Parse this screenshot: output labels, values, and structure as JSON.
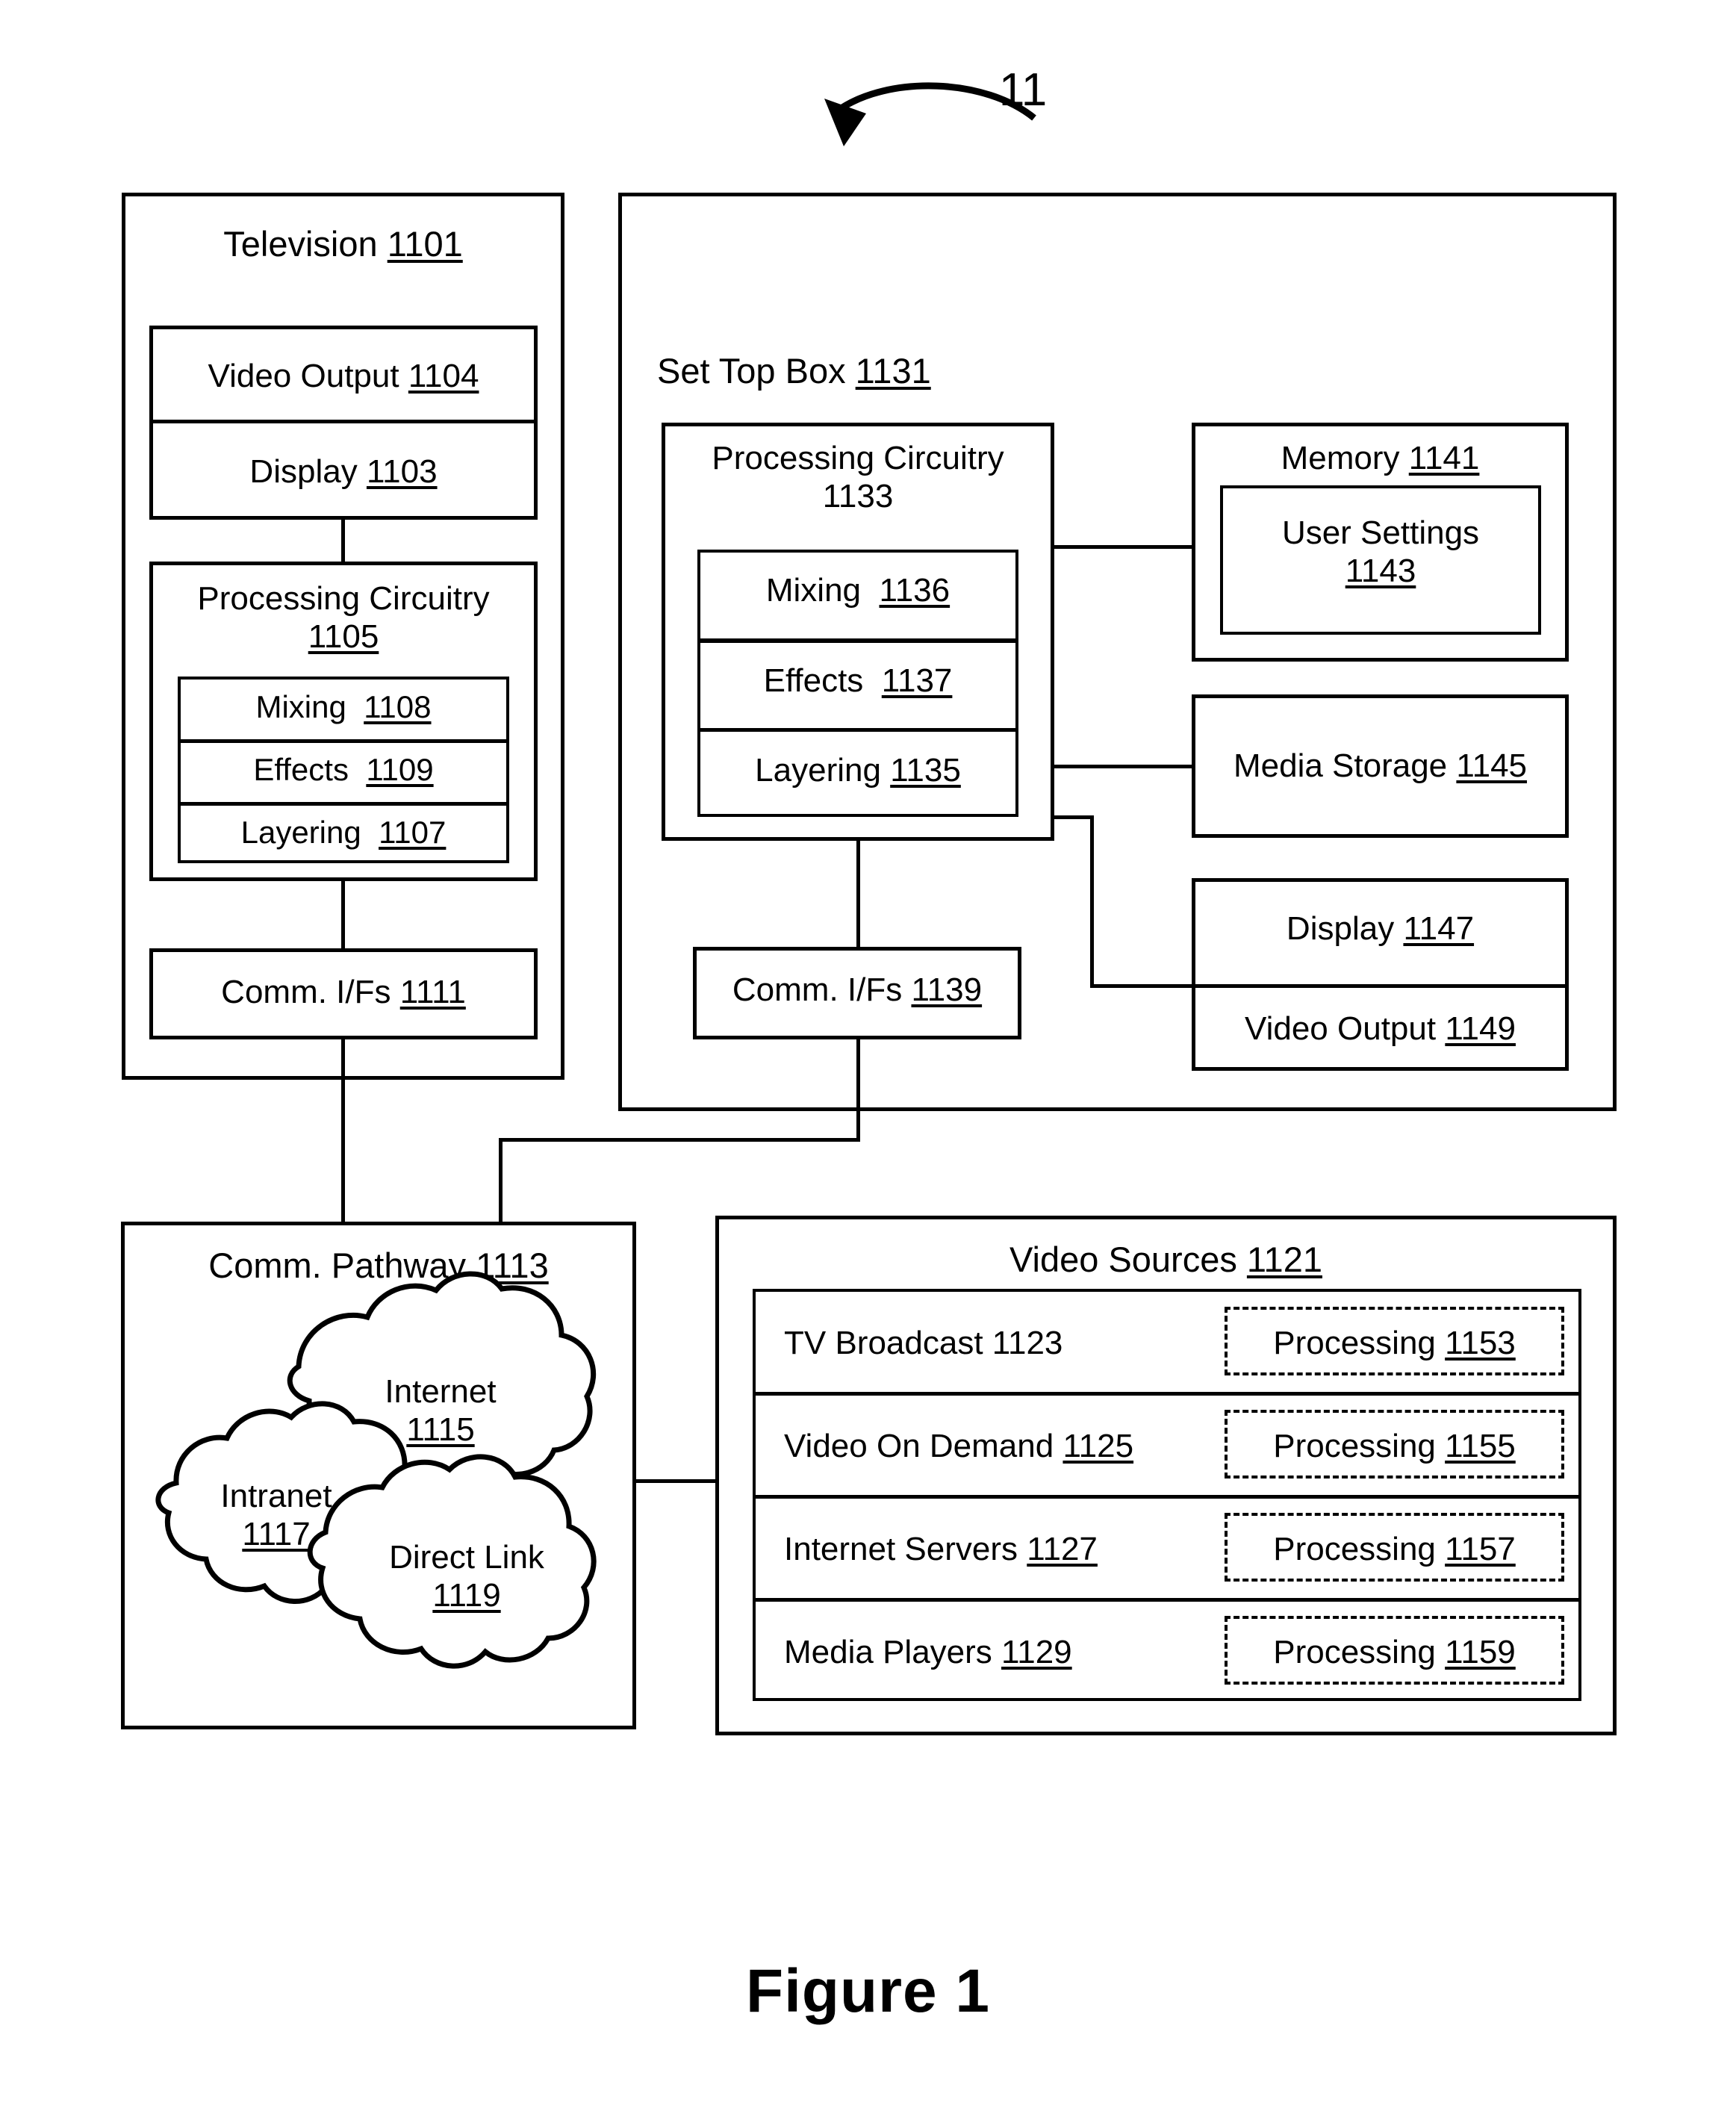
{
  "figure": {
    "caption": "Figure 1",
    "ref_marker": "11"
  },
  "television": {
    "title": "Television",
    "title_ref": "1101",
    "video_output": {
      "label": "Video Output",
      "ref": "1104"
    },
    "display": {
      "label": "Display",
      "ref": "1103"
    },
    "processing": {
      "label_line1": "Processing Circuitry",
      "label_line2": "1105",
      "blocks": [
        {
          "label": "Mixing",
          "ref": "1108"
        },
        {
          "label": "Effects",
          "ref": "1109"
        },
        {
          "label": "Layering",
          "ref": "1107"
        }
      ]
    },
    "comm_ifs": {
      "label": "Comm. I/Fs",
      "ref": "1111"
    }
  },
  "set_top_box": {
    "title": "Set Top Box",
    "title_ref": "1131",
    "processing": {
      "label_line1": "Processing Circuitry",
      "label_line2": "1133",
      "blocks": [
        {
          "label": "Mixing",
          "ref": "1136"
        },
        {
          "label": "Effects",
          "ref": "1137"
        },
        {
          "label": "Layering",
          "ref": "1135"
        }
      ]
    },
    "comm_ifs": {
      "label": "Comm. I/Fs",
      "ref": "1139"
    },
    "memory": {
      "label": "Memory",
      "ref": "1141",
      "user_settings": {
        "label": "User Settings",
        "ref": "1143"
      }
    },
    "media_storage": {
      "label": "Media Storage",
      "ref": "1145"
    },
    "display": {
      "label": "Display",
      "ref": "1147"
    },
    "video_output": {
      "label": "Video Output",
      "ref": "1149"
    }
  },
  "comm_pathway": {
    "title": "Comm. Pathway",
    "title_ref": "1113",
    "clouds": [
      {
        "label": "Internet",
        "ref": "1115"
      },
      {
        "label": "Intranet",
        "ref": "1117"
      },
      {
        "label": "Direct Link",
        "ref": "1119"
      }
    ]
  },
  "video_sources": {
    "title": "Video Sources",
    "title_ref": "1121",
    "rows": [
      {
        "label": "TV Broadcast 1123",
        "processing": "Processing",
        "processing_ref": "1153"
      },
      {
        "label": "Video On Demand",
        "label_ref": "1125",
        "processing": "Processing",
        "processing_ref": "1155"
      },
      {
        "label": "Internet Servers",
        "label_ref": "1127",
        "processing": "Processing",
        "processing_ref": "1157"
      },
      {
        "label": "Media Players",
        "label_ref": "1129",
        "processing": "Processing",
        "processing_ref": "1159"
      }
    ]
  },
  "colors": {
    "ink": "#000000",
    "paper": "#ffffff"
  }
}
